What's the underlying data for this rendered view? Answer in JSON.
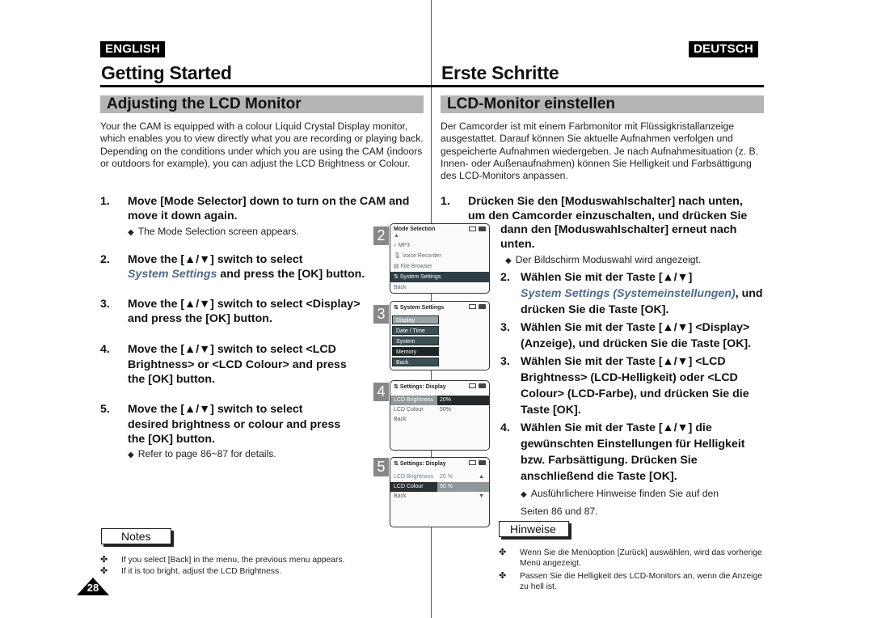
{
  "header": {
    "lang_en": "ENGLISH",
    "lang_de": "DEUTSCH",
    "title_en": "Getting Started",
    "title_de": "Erste Schritte"
  },
  "english": {
    "section_title": "Adjusting the LCD Monitor",
    "intro": "Your the CAM is equipped with a colour Liquid Crystal Display monitor, which enables you to view directly what you are recording or playing back. Depending on the conditions under which you are using the CAM (indoors or outdoors for example), you can adjust the LCD Brightness or Colour.",
    "steps": [
      {
        "num": "1.",
        "text": "Move [Mode Selector] down to turn on the CAM and move it down again.",
        "sub": "The Mode Selection screen appears."
      },
      {
        "num": "2.",
        "text_before": "Move the [▲/▼] switch to select",
        "italic": "System Settings",
        "text_after": "and press the [OK] button."
      },
      {
        "num": "3.",
        "text": "Move the [▲/▼] switch to select <Display> and press the [OK] button."
      },
      {
        "num": "4.",
        "text": "Move the [▲/▼] switch to select <LCD Brightness> or <LCD Colour> and press the [OK] button."
      },
      {
        "num": "5.",
        "text": "Move the [▲/▼] switch to select desired brightness or colour and press the [OK] button.",
        "sub": "Refer to page 86~87 for details."
      }
    ],
    "notes_label": "Notes",
    "notes": [
      "If you select [Back] in the menu, the previous menu appears.",
      "If it is too bright, adjust the LCD Brightness."
    ],
    "page_number": "28"
  },
  "deutsch": {
    "section_title": "LCD-Monitor einstellen",
    "intro": "Der Camcorder ist mit einem Farbmonitor mit Flüssigkristallanzeige ausgestattet. Darauf können Sie aktuelle Aufnahmen verfolgen und gespeicherte Aufnahmen wiedergeben. Je nach Aufnahmesituation (z. B. Innen- oder Außenaufnahmen) können Sie Helligkeit und Farbsättigung des LCD-Monitors anpassen.",
    "steps": [
      {
        "num": "1.",
        "line1": "Drücken Sie den [Moduswahlschalter] nach unten,",
        "line2": "um den Camcorder einzuschalten, und drücken Sie",
        "line3": "dann den [Moduswahlschalter] erneut nach unten.",
        "sub": "Der Bildschirm Moduswahl wird angezeigt."
      },
      {
        "num": "2.",
        "text_before": "Wählen Sie mit der Taste [▲/▼]",
        "italic": "System Settings (Systemeinstellungen)",
        "text_after": ", und drücken Sie die Taste [OK]."
      },
      {
        "num": "3.",
        "text": "Wählen Sie mit der Taste [▲/▼] <Display> (Anzeige), und drücken Sie die Taste [OK]."
      },
      {
        "num": "3.",
        "text": "Wählen Sie mit der Taste [▲/▼] <LCD Brightness> (LCD-Helligkeit) oder <LCD Colour> (LCD-Farbe), und drücken Sie die Taste [OK]."
      },
      {
        "num": "4.",
        "text": "Wählen Sie mit der Taste [▲/▼] die gewünschten Einstellungen für Helligkeit bzw. Farbsättigung. Drücken Sie anschließend die Taste [OK].",
        "sub": "Ausführlichere Hinweise finden Sie auf den Seiten 86 und 87."
      }
    ],
    "notes_label": "Hinweise",
    "notes": [
      "Wenn Sie die Menüoption [Zurück] auswählen, wird das vorherige Menü angezeigt.",
      "Passen Sie die Helligkeit des LCD-Monitors an, wenn die Anzeige zu hell ist."
    ]
  },
  "screens": [
    {
      "num": "2",
      "title": "Mode Selection",
      "items": [
        "MP3",
        "Voice Recorder",
        "File Browser",
        "System Settings",
        "Back"
      ],
      "selected": "System Settings"
    },
    {
      "num": "3",
      "title": "System Settings",
      "items": [
        "Display",
        "Date / Time",
        "System",
        "Memory",
        "Back"
      ],
      "selected": "Display"
    },
    {
      "num": "4",
      "title": "Settings: Display",
      "rows": [
        {
          "label": "LCD Brightness",
          "value": "20%"
        },
        {
          "label": "LCD Colour",
          "value": "50%"
        },
        {
          "label": "Back",
          "value": ""
        }
      ],
      "selected": "LCD Brightness"
    },
    {
      "num": "5",
      "title": "Settings: Display",
      "rows": [
        {
          "label": "LCD Brightness",
          "value": "20 %"
        },
        {
          "label": "LCD Colour",
          "value": "60 %"
        },
        {
          "label": "Back",
          "value": ""
        }
      ],
      "selected": "LCD Colour"
    }
  ]
}
